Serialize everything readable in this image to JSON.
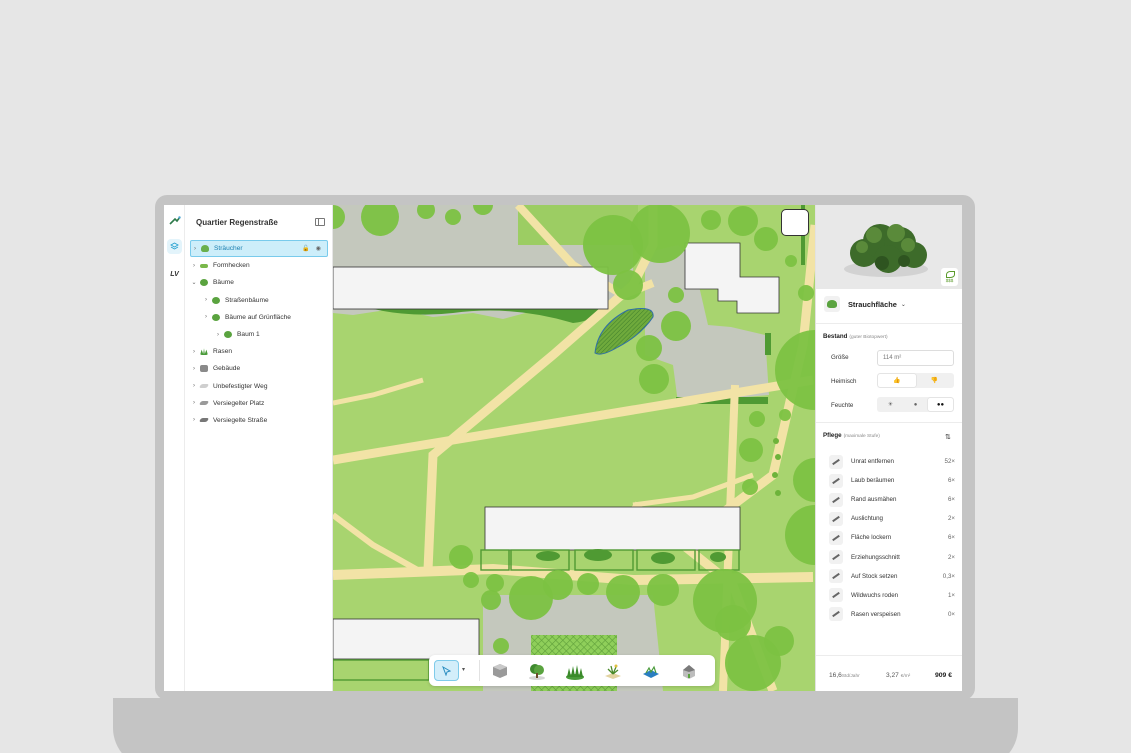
{
  "project": {
    "title": "Quartier Regenstraße"
  },
  "rail": {
    "lv_label": "LV"
  },
  "layers": [
    {
      "label": "Sträucher",
      "indent": 0,
      "expanded": false,
      "icon": "shrub-icon",
      "selected": true
    },
    {
      "label": "Formhecken",
      "indent": 0,
      "expanded": false,
      "icon": "hedge-icon"
    },
    {
      "label": "Bäume",
      "indent": 0,
      "expanded": true,
      "icon": "tree-icon"
    },
    {
      "label": "Straßenbäume",
      "indent": 1,
      "expanded": false,
      "icon": "tree-icon"
    },
    {
      "label": "Bäume auf Grünfläche",
      "indent": 1,
      "expanded": false,
      "icon": "tree-icon"
    },
    {
      "label": "Baum 1",
      "indent": 2,
      "expanded": false,
      "icon": "tree-icon"
    },
    {
      "label": "Rasen",
      "indent": 0,
      "expanded": false,
      "icon": "grass-icon"
    },
    {
      "label": "Gebäude",
      "indent": 0,
      "expanded": false,
      "icon": "building-icon"
    },
    {
      "label": "Unbefestigter Weg",
      "indent": 0,
      "expanded": false,
      "icon": "path-icon"
    },
    {
      "label": "Versiegelter Platz",
      "indent": 0,
      "expanded": false,
      "icon": "plaza-icon"
    },
    {
      "label": "Versiegelte Straße",
      "indent": 0,
      "expanded": false,
      "icon": "road-icon"
    }
  ],
  "hero": {
    "badge": "$$$"
  },
  "detail": {
    "type_label": "Strauchfläche",
    "bestand": {
      "title": "Bestand",
      "subtitle": "(guter Biotopwert)",
      "size_label": "Größe",
      "size_value": "114 m²",
      "native_label": "Heimisch",
      "moisture_label": "Feuchte"
    },
    "pflege": {
      "title": "Pflege",
      "subtitle": "(maximale Stufe)",
      "items": [
        {
          "label": "Unrat entfernen",
          "count": "52×"
        },
        {
          "label": "Laub beräumen",
          "count": "6×"
        },
        {
          "label": "Rand ausmähen",
          "count": "6×"
        },
        {
          "label": "Auslichtung",
          "count": "2×"
        },
        {
          "label": "Fläche lockern",
          "count": "6×"
        },
        {
          "label": "Erziehungsschnitt",
          "count": "2×"
        },
        {
          "label": "Auf Stock setzen",
          "count": "0,3×"
        },
        {
          "label": "Wildwuchs roden",
          "count": "1×"
        },
        {
          "label": "Rasen verspeisen",
          "count": "0×"
        }
      ]
    },
    "footer": {
      "hours": "16,6",
      "hours_unit": "Std/Jahr",
      "rate": "3,27",
      "rate_unit": "€/m²",
      "total": "909 €"
    }
  },
  "colors": {
    "lawn": "#a8d46f",
    "lawn_dark": "#8fc35a",
    "tree": "#7cc242",
    "path": "#f2e3a6",
    "building": "#f4f4f4",
    "plaza": "#c4c8bd",
    "accent": "#2aa3d1"
  }
}
